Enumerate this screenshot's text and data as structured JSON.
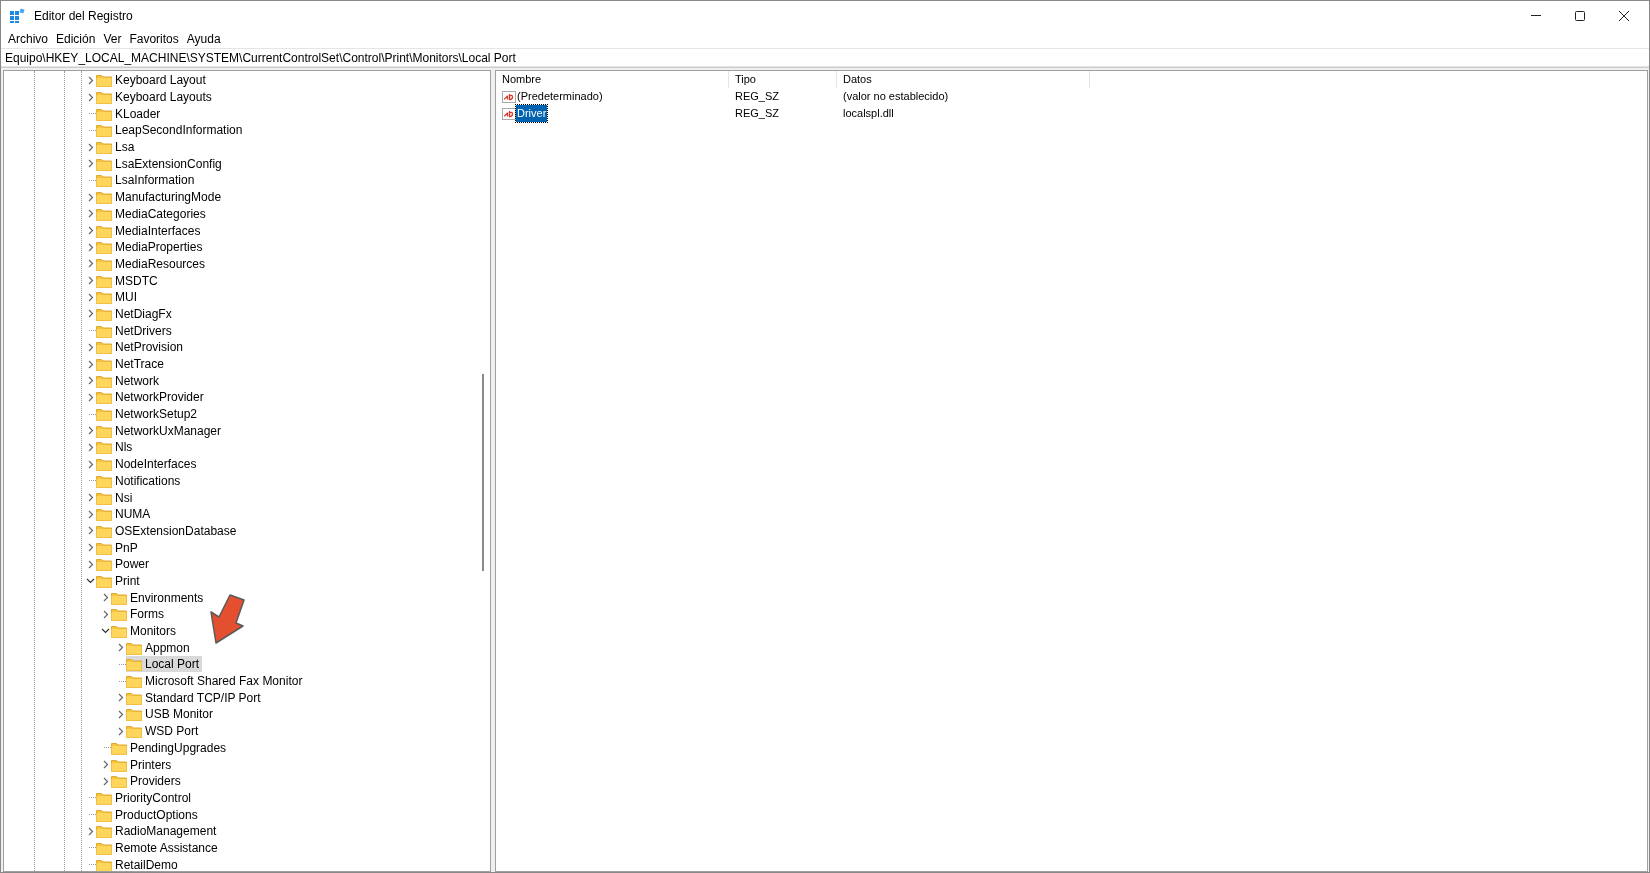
{
  "window": {
    "title": "Editor del Registro"
  },
  "menu": [
    "Archivo",
    "Edición",
    "Ver",
    "Favoritos",
    "Ayuda"
  ],
  "address": "Equipo\\HKEY_LOCAL_MACHINE\\SYSTEM\\CurrentControlSet\\Control\\Print\\Monitors\\Local Port",
  "tree": {
    "items": [
      {
        "label": "Keyboard Layout",
        "has_children": true,
        "expanded": false,
        "selected": false
      },
      {
        "label": "Keyboard Layouts",
        "has_children": true,
        "expanded": false,
        "selected": false
      },
      {
        "label": "KLoader",
        "has_children": false,
        "selected": false
      },
      {
        "label": "LeapSecondInformation",
        "has_children": false,
        "selected": false
      },
      {
        "label": "Lsa",
        "has_children": true,
        "expanded": false,
        "selected": false
      },
      {
        "label": "LsaExtensionConfig",
        "has_children": true,
        "expanded": false,
        "selected": false
      },
      {
        "label": "LsaInformation",
        "has_children": false,
        "selected": false
      },
      {
        "label": "ManufacturingMode",
        "has_children": true,
        "expanded": false,
        "selected": false
      },
      {
        "label": "MediaCategories",
        "has_children": true,
        "expanded": false,
        "selected": false
      },
      {
        "label": "MediaInterfaces",
        "has_children": true,
        "expanded": false,
        "selected": false
      },
      {
        "label": "MediaProperties",
        "has_children": true,
        "expanded": false,
        "selected": false
      },
      {
        "label": "MediaResources",
        "has_children": true,
        "expanded": false,
        "selected": false
      },
      {
        "label": "MSDTC",
        "has_children": true,
        "expanded": false,
        "selected": false
      },
      {
        "label": "MUI",
        "has_children": true,
        "expanded": false,
        "selected": false
      },
      {
        "label": "NetDiagFx",
        "has_children": true,
        "expanded": false,
        "selected": false
      },
      {
        "label": "NetDrivers",
        "has_children": false,
        "selected": false
      },
      {
        "label": "NetProvision",
        "has_children": true,
        "expanded": false,
        "selected": false
      },
      {
        "label": "NetTrace",
        "has_children": true,
        "expanded": false,
        "selected": false
      },
      {
        "label": "Network",
        "has_children": true,
        "expanded": false,
        "selected": false
      },
      {
        "label": "NetworkProvider",
        "has_children": true,
        "expanded": false,
        "selected": false
      },
      {
        "label": "NetworkSetup2",
        "has_children": false,
        "selected": false
      },
      {
        "label": "NetworkUxManager",
        "has_children": true,
        "expanded": false,
        "selected": false
      },
      {
        "label": "Nls",
        "has_children": true,
        "expanded": false,
        "selected": false
      },
      {
        "label": "NodeInterfaces",
        "has_children": true,
        "expanded": false,
        "selected": false
      },
      {
        "label": "Notifications",
        "has_children": false,
        "selected": false
      },
      {
        "label": "Nsi",
        "has_children": true,
        "expanded": false,
        "selected": false
      },
      {
        "label": "NUMA",
        "has_children": true,
        "expanded": false,
        "selected": false
      },
      {
        "label": "OSExtensionDatabase",
        "has_children": true,
        "expanded": false,
        "selected": false
      },
      {
        "label": "PnP",
        "has_children": true,
        "expanded": false,
        "selected": false
      },
      {
        "label": "Power",
        "has_children": true,
        "expanded": false,
        "selected": false
      },
      {
        "label": "Print",
        "has_children": true,
        "expanded": true,
        "selected": false,
        "children": [
          {
            "label": "Environments",
            "has_children": true,
            "expanded": false,
            "selected": false
          },
          {
            "label": "Forms",
            "has_children": true,
            "expanded": false,
            "selected": false
          },
          {
            "label": "Monitors",
            "has_children": true,
            "expanded": true,
            "selected": false,
            "children": [
              {
                "label": "Appmon",
                "has_children": true,
                "expanded": false,
                "selected": false
              },
              {
                "label": "Local Port",
                "has_children": false,
                "selected": true
              },
              {
                "label": "Microsoft Shared Fax Monitor",
                "has_children": false,
                "selected": false
              },
              {
                "label": "Standard TCP/IP Port",
                "has_children": true,
                "expanded": false,
                "selected": false
              },
              {
                "label": "USB Monitor",
                "has_children": true,
                "expanded": false,
                "selected": false
              },
              {
                "label": "WSD Port",
                "has_children": true,
                "expanded": false,
                "selected": false
              }
            ]
          },
          {
            "label": "PendingUpgrades",
            "has_children": false,
            "selected": false
          },
          {
            "label": "Printers",
            "has_children": true,
            "expanded": false,
            "selected": false
          },
          {
            "label": "Providers",
            "has_children": true,
            "expanded": false,
            "selected": false
          }
        ]
      },
      {
        "label": "PriorityControl",
        "has_children": false,
        "selected": false
      },
      {
        "label": "ProductOptions",
        "has_children": false,
        "selected": false
      },
      {
        "label": "RadioManagement",
        "has_children": true,
        "expanded": false,
        "selected": false
      },
      {
        "label": "Remote Assistance",
        "has_children": false,
        "selected": false
      },
      {
        "label": "RetailDemo",
        "has_children": false,
        "selected": false
      }
    ]
  },
  "values": {
    "columns": [
      "Nombre",
      "Tipo",
      "Datos"
    ],
    "rows": [
      {
        "name": "(Predeterminado)",
        "type": "REG_SZ",
        "data": "(valor no establecido)",
        "selected": false
      },
      {
        "name": "Driver",
        "type": "REG_SZ",
        "data": "localspl.dll",
        "selected": true
      }
    ]
  }
}
